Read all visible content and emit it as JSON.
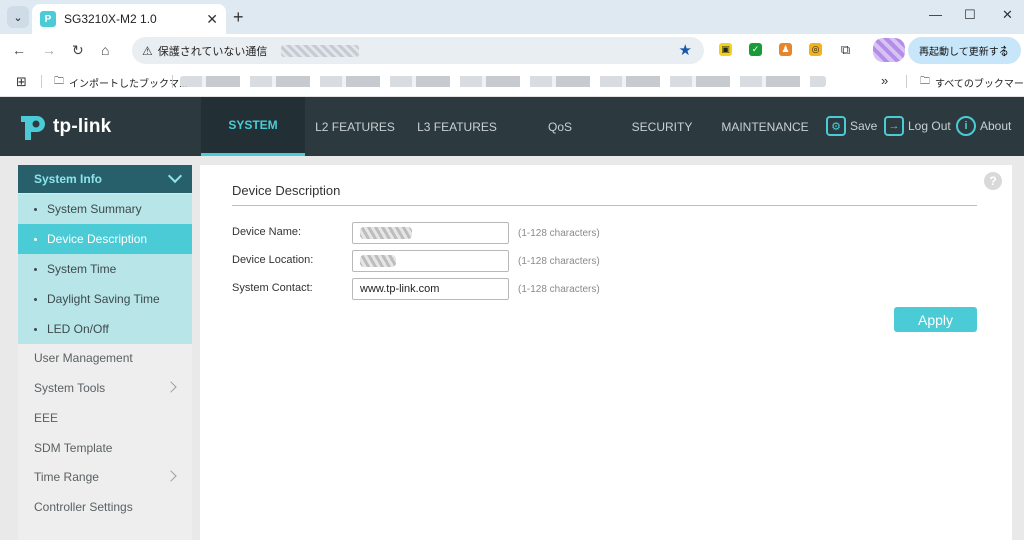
{
  "browser": {
    "tab_title": "SG3210X-M2 1.0",
    "address_warning": "保護されていない通信",
    "update_button": "再起動して更新する",
    "bookmark_imported": "インポートしたブックマ...",
    "bookmark_all": "すべてのブックマーク"
  },
  "app": {
    "brand": "tp-link",
    "nav": [
      "SYSTEM",
      "L2 FEATURES",
      "L3 FEATURES",
      "QoS",
      "SECURITY",
      "MAINTENANCE"
    ],
    "actions": {
      "save": "Save",
      "logout": "Log Out",
      "about": "About"
    },
    "accent_color": "#4acbd6",
    "header_color": "#2c3a3f"
  },
  "sidebar": {
    "section": "System Info",
    "sub_items": [
      "System Summary",
      "Device Description",
      "System Time",
      "Daylight Saving Time",
      "LED On/Off"
    ],
    "active_sub_item": "Device Description",
    "items": [
      "User Management",
      "System Tools",
      "EEE",
      "SDM Template",
      "Time Range",
      "Controller Settings"
    ]
  },
  "panel": {
    "title": "Device Description",
    "fields": [
      {
        "label": "Device Name:",
        "value": "",
        "hint": "(1-128 characters)"
      },
      {
        "label": "Device Location:",
        "value": "",
        "hint": "(1-128 characters)"
      },
      {
        "label": "System Contact:",
        "value": "www.tp-link.com",
        "hint": "(1-128 characters)"
      }
    ],
    "apply_label": "Apply",
    "help_icon": "?"
  }
}
